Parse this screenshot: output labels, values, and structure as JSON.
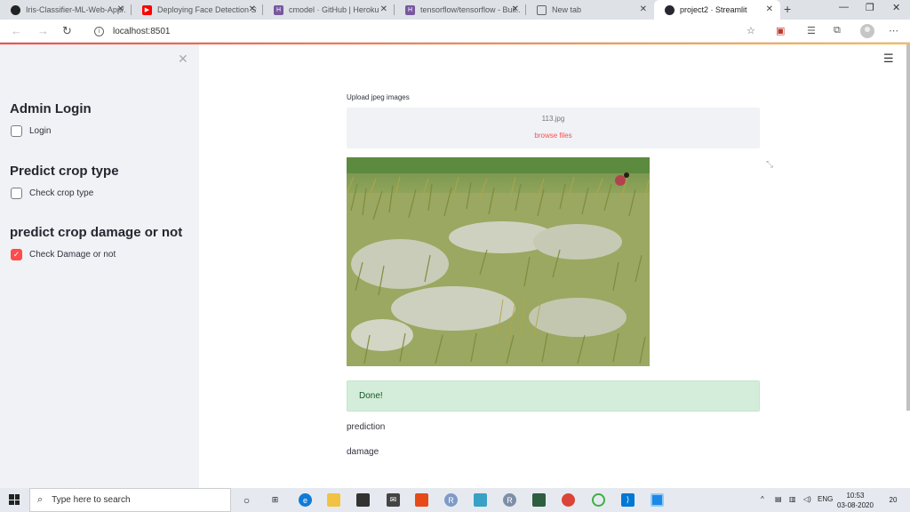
{
  "browser": {
    "tabs": [
      {
        "title": "Iris-Classifier-ML-Web-App/...",
        "icon": "github-icon",
        "color": "#222222"
      },
      {
        "title": "Deploying Face Detection St...",
        "icon": "youtube-icon",
        "color": "#ff0000"
      },
      {
        "title": "cmodel · GitHub | Heroku",
        "icon": "heroku-icon",
        "color": "#79589f"
      },
      {
        "title": "tensorflow/tensorflow - Buil...",
        "icon": "heroku-icon",
        "color": "#79589f"
      },
      {
        "title": "New tab",
        "icon": "newtab-icon",
        "color": "#666666"
      },
      {
        "title": "project2 · Streamlit",
        "icon": "streamlit-icon",
        "color": "#262730"
      }
    ],
    "url": "localhost:8501"
  },
  "sidebar": {
    "sections": [
      {
        "header": "Admin Login",
        "checkbox_label": "Login",
        "checked": false
      },
      {
        "header": "Predict crop type",
        "checkbox_label": "Check crop type",
        "checked": false
      },
      {
        "header": "predict crop damage or not",
        "checkbox_label": "Check Damage or not",
        "checked": true
      }
    ]
  },
  "main": {
    "upload_label": "Upload jpeg images",
    "uploaded_file": "113.jpg",
    "browse_label": "browse files",
    "success_message": "Done!",
    "prediction_label": "prediction",
    "prediction_value": "damage"
  },
  "taskbar": {
    "search_placeholder": "Type here to search",
    "language": "ENG",
    "time": "10:53",
    "date": "03-08-2020",
    "notification_count": "20"
  }
}
